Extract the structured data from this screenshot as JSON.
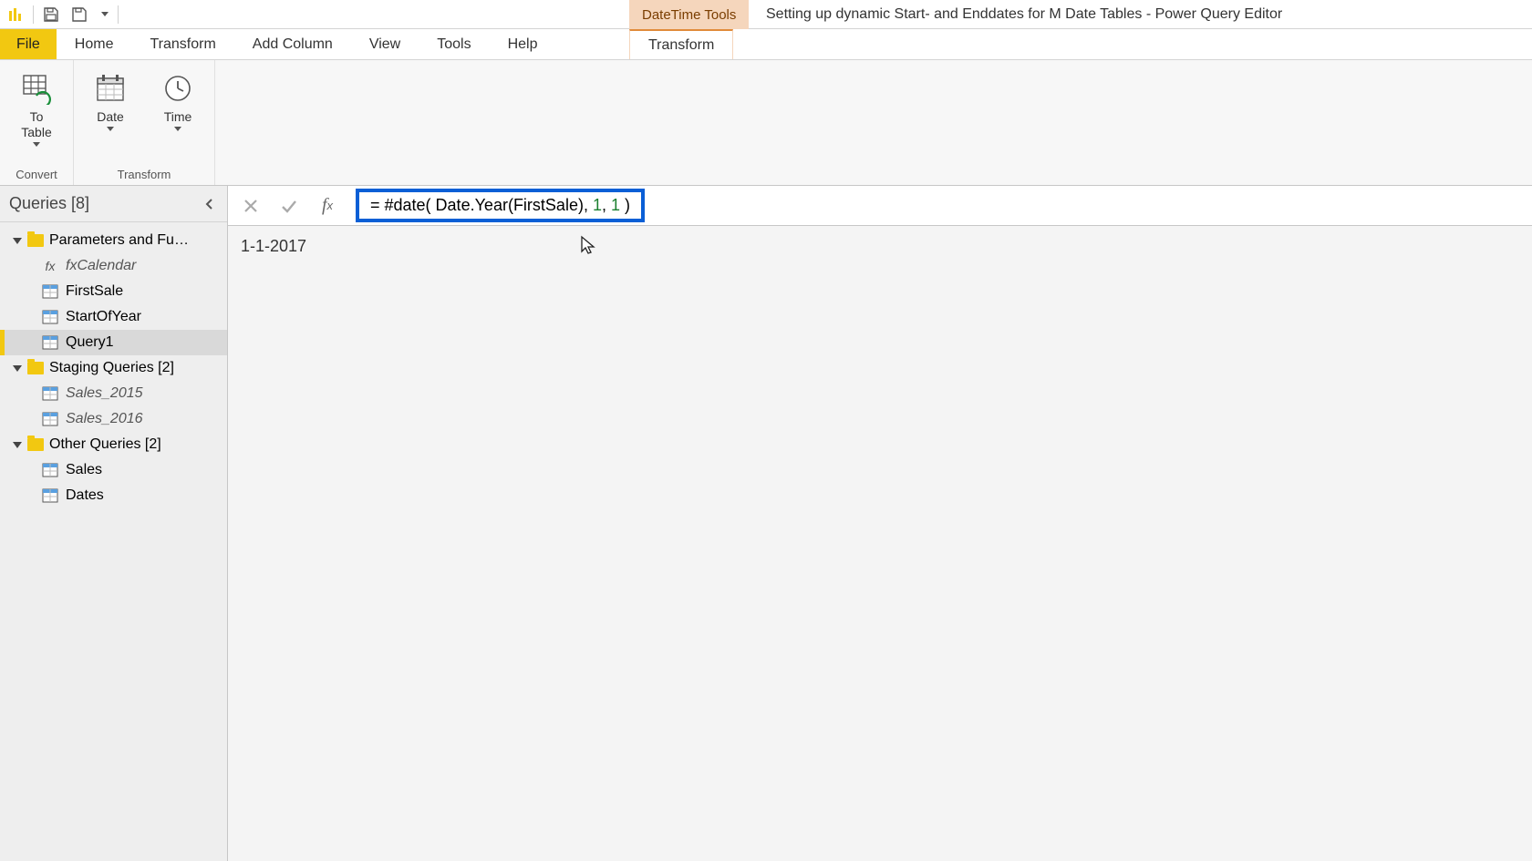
{
  "title": {
    "context_tab": "DateTime Tools",
    "window": "Setting up dynamic Start- and Enddates for M Date Tables - Power Query Editor"
  },
  "tabs": {
    "file": "File",
    "home": "Home",
    "transform": "Transform",
    "addcolumn": "Add Column",
    "view": "View",
    "tools": "Tools",
    "help": "Help",
    "context_transform": "Transform"
  },
  "ribbon": {
    "convert_group": "Convert",
    "transform_group": "Transform",
    "to_table": "To\nTable",
    "date": "Date",
    "time": "Time"
  },
  "queries": {
    "header": "Queries [8]",
    "folders": {
      "params": "Parameters and Functions",
      "staging": "Staging Queries [2]",
      "other": "Other Queries [2]"
    },
    "items": {
      "fxcalendar": "fxCalendar",
      "firstsale": "FirstSale",
      "startofyear": "StartOfYear",
      "query1": "Query1",
      "sales2015": "Sales_2015",
      "sales2016": "Sales_2016",
      "sales": "Sales",
      "dates": "Dates"
    }
  },
  "formula": {
    "prefix": "= #date( Date.Year(FirstSale), ",
    "n1": "1",
    "sep": ", ",
    "n2": "1",
    "suffix": " )"
  },
  "result": "1-1-2017"
}
